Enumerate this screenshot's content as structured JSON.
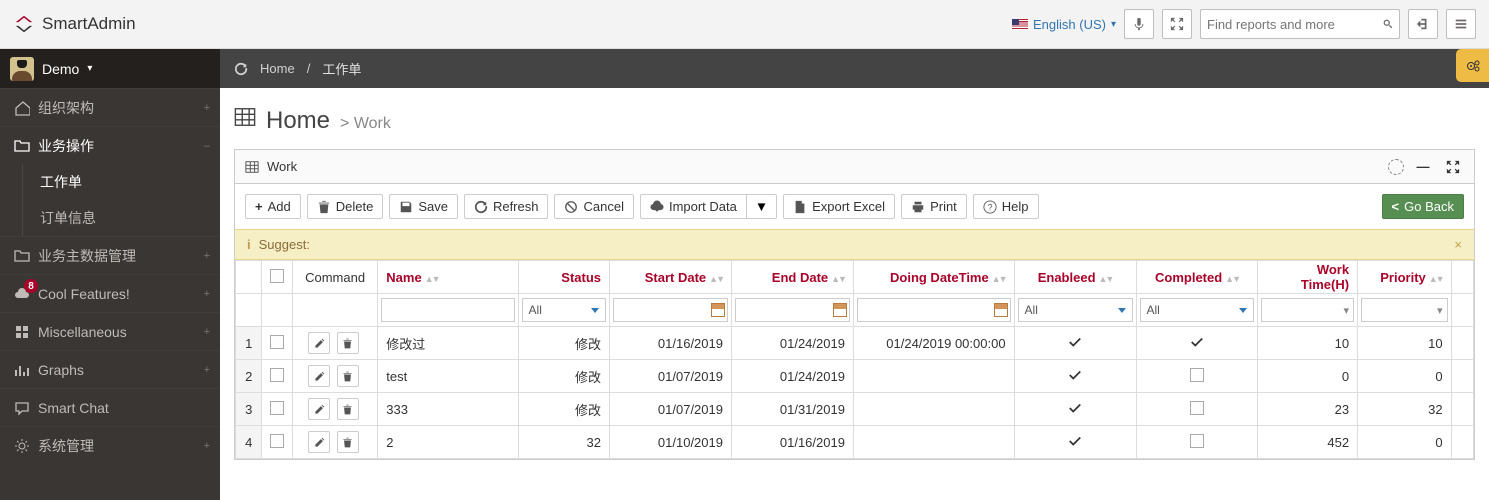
{
  "header": {
    "brand": "SmartAdmin",
    "language": "English (US)",
    "search_placeholder": "Find reports and more"
  },
  "sidebar": {
    "user": "Demo",
    "items": [
      {
        "icon": "home",
        "label": "组织架构",
        "expandable": true
      },
      {
        "icon": "folder",
        "label": "业务操作",
        "expandable": true,
        "open": true,
        "children": [
          {
            "label": "工作单",
            "active": true
          },
          {
            "label": "订单信息"
          }
        ]
      },
      {
        "icon": "folder",
        "label": "业务主数据管理",
        "expandable": true
      },
      {
        "icon": "cloud",
        "label": "Cool Features!",
        "expandable": true,
        "badge": "8"
      },
      {
        "icon": "win",
        "label": "Miscellaneous",
        "expandable": true
      },
      {
        "icon": "chart",
        "label": "Graphs",
        "expandable": true
      },
      {
        "icon": "chat",
        "label": "Smart Chat"
      },
      {
        "icon": "gear",
        "label": "系统管理",
        "expandable": true
      }
    ]
  },
  "breadcrumb": {
    "home": "Home",
    "current": "工作单"
  },
  "page": {
    "title_main": "Home",
    "title_sub": "Work"
  },
  "widget": {
    "title": "Work",
    "toolbar": {
      "add": "Add",
      "delete": "Delete",
      "save": "Save",
      "refresh": "Refresh",
      "cancel": "Cancel",
      "import": "Import Data",
      "export": "Export Excel",
      "print": "Print",
      "help": "Help",
      "goback": "Go Back"
    },
    "suggest": "Suggest:",
    "columns": {
      "command": "Command",
      "name": "Name",
      "status": "Status",
      "start": "Start Date",
      "end": "End Date",
      "doing": "Doing DateTime",
      "enabled": "Enableed",
      "completed": "Completed",
      "worktime": "Work Time(H)",
      "priority": "Priority"
    },
    "filter_all": "All",
    "rows": [
      {
        "n": 1,
        "name": "修改过",
        "status": "修改",
        "start": "01/16/2019",
        "end": "01/24/2019",
        "doing": "01/24/2019 00:00:00",
        "enabled": true,
        "completed": true,
        "worktime": 10,
        "priority": 10
      },
      {
        "n": 2,
        "name": "test",
        "status": "修改",
        "start": "01/07/2019",
        "end": "01/24/2019",
        "doing": "",
        "enabled": true,
        "completed": false,
        "worktime": 0,
        "priority": 0
      },
      {
        "n": 3,
        "name": "333",
        "status": "修改",
        "start": "01/07/2019",
        "end": "01/31/2019",
        "doing": "",
        "enabled": true,
        "completed": false,
        "worktime": 23,
        "priority": 32
      },
      {
        "n": 4,
        "name": "2",
        "status": "32",
        "start": "01/10/2019",
        "end": "01/16/2019",
        "doing": "",
        "enabled": true,
        "completed": false,
        "worktime": 452,
        "priority": 0
      }
    ]
  }
}
